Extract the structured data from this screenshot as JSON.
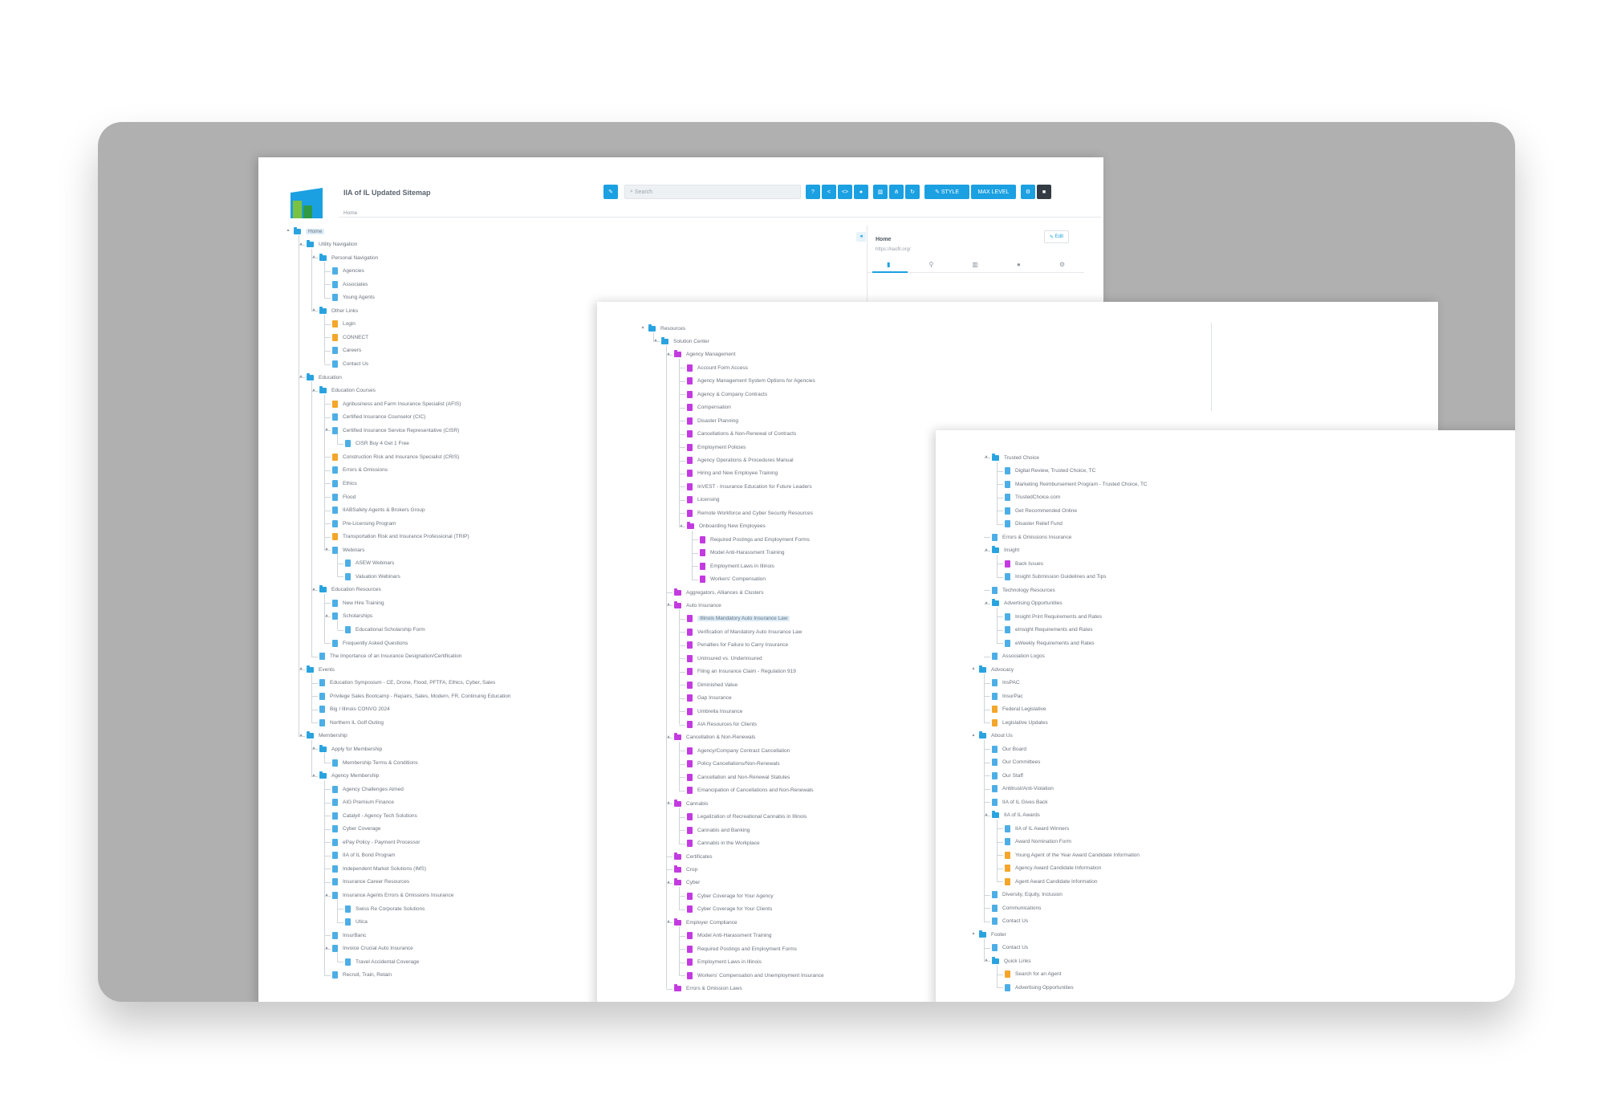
{
  "app": {
    "title": "IIA of IL Updated Sitemap",
    "breadcrumb": "Home",
    "search_placeholder": "Search",
    "toolbar": [
      "STYLE",
      "MAX LEVEL"
    ],
    "side_panel": {
      "title": "Home",
      "url": "https://iiaofil.org/",
      "edit_label": "Edit"
    }
  },
  "colors": {
    "folder": "#29a3df",
    "page_blue": "#4daee6",
    "page_orange": "#f4a62a",
    "page_purple": "#c33be0",
    "accent": "#1ba0e2",
    "stage": "#b0b0b0"
  },
  "sheet1_tree": [
    {
      "d": 0,
      "t": "Home",
      "k": "folder",
      "hl": true
    },
    {
      "d": 1,
      "t": "Utility Navigation",
      "k": "folder"
    },
    {
      "d": 2,
      "t": "Personal Navigation",
      "k": "folder"
    },
    {
      "d": 3,
      "t": "Agencies",
      "k": "blue"
    },
    {
      "d": 3,
      "t": "Associates",
      "k": "blue"
    },
    {
      "d": 3,
      "t": "Young Agents",
      "k": "blue"
    },
    {
      "d": 2,
      "t": "Other Links",
      "k": "folder"
    },
    {
      "d": 3,
      "t": "Login",
      "k": "orange"
    },
    {
      "d": 3,
      "t": "CONNECT",
      "k": "orange"
    },
    {
      "d": 3,
      "t": "Careers",
      "k": "blue"
    },
    {
      "d": 3,
      "t": "Contact Us",
      "k": "blue"
    },
    {
      "d": 1,
      "t": "Education",
      "k": "folder"
    },
    {
      "d": 2,
      "t": "Education Courses",
      "k": "folder"
    },
    {
      "d": 3,
      "t": "Agribusiness and Farm Insurance Specialist (AFIS)",
      "k": "orange"
    },
    {
      "d": 3,
      "t": "Certified Insurance Counselor (CIC)",
      "k": "blue"
    },
    {
      "d": 3,
      "t": "Certified Insurance Service Representative (CISR)",
      "k": "blue"
    },
    {
      "d": 4,
      "t": "CISR Buy 4 Get 1 Free",
      "k": "blue"
    },
    {
      "d": 3,
      "t": "Construction Risk and Insurance Specialist (CRIS)",
      "k": "orange"
    },
    {
      "d": 3,
      "t": "Errors & Omissions",
      "k": "blue"
    },
    {
      "d": 3,
      "t": "Ethics",
      "k": "blue"
    },
    {
      "d": 3,
      "t": "Flood",
      "k": "blue"
    },
    {
      "d": 3,
      "t": "IIABSafety Agents & Brokers Group",
      "k": "blue"
    },
    {
      "d": 3,
      "t": "Pre-Licensing Program",
      "k": "blue"
    },
    {
      "d": 3,
      "t": "Transportation Risk and Insurance Professional (TRIP)",
      "k": "orange"
    },
    {
      "d": 3,
      "t": "Webinars",
      "k": "blue"
    },
    {
      "d": 4,
      "t": "ASEW Webinars",
      "k": "blue"
    },
    {
      "d": 4,
      "t": "Valuation Webinars",
      "k": "blue"
    },
    {
      "d": 2,
      "t": "Education Resources",
      "k": "folder"
    },
    {
      "d": 3,
      "t": "New Hire Training",
      "k": "blue"
    },
    {
      "d": 3,
      "t": "Scholarships",
      "k": "blue"
    },
    {
      "d": 4,
      "t": "Educational Scholarship Form",
      "k": "blue"
    },
    {
      "d": 3,
      "t": "Frequently Asked Questions",
      "k": "blue"
    },
    {
      "d": 2,
      "t": "The Importance of an Insurance Designation/Certification",
      "k": "blue"
    },
    {
      "d": 1,
      "t": "Events",
      "k": "folder"
    },
    {
      "d": 2,
      "t": "Education Symposium - CE, Drone, Flood, PFTFA, Ethics, Cyber, Sales",
      "k": "blue"
    },
    {
      "d": 2,
      "t": "Privilege Sales Bootcamp - Repairs, Sales, Modern, FR, Continuing Education",
      "k": "blue"
    },
    {
      "d": 2,
      "t": "Big I Illinois CONVO 2024",
      "k": "blue"
    },
    {
      "d": 2,
      "t": "Northern IL Golf Outing",
      "k": "blue"
    },
    {
      "d": 1,
      "t": "Membership",
      "k": "folder"
    },
    {
      "d": 2,
      "t": "Apply for Membership",
      "k": "folder"
    },
    {
      "d": 3,
      "t": "Membership Terms & Conditions",
      "k": "blue"
    },
    {
      "d": 2,
      "t": "Agency Membership",
      "k": "folder"
    },
    {
      "d": 3,
      "t": "Agency Challenges Aimed",
      "k": "blue"
    },
    {
      "d": 3,
      "t": "AIG Premium Finance",
      "k": "blue"
    },
    {
      "d": 3,
      "t": "Catalyit - Agency Tech Solutions",
      "k": "blue"
    },
    {
      "d": 3,
      "t": "Cyber Coverage",
      "k": "blue"
    },
    {
      "d": 3,
      "t": "ePay Policy - Payment Processor",
      "k": "blue"
    },
    {
      "d": 3,
      "t": "IIA of IL Bond Program",
      "k": "blue"
    },
    {
      "d": 3,
      "t": "Independent Market Solutions (IMS)",
      "k": "blue"
    },
    {
      "d": 3,
      "t": "Insurance Career Resources",
      "k": "blue"
    },
    {
      "d": 3,
      "t": "Insurance Agents Errors & Omissions Insurance",
      "k": "blue"
    },
    {
      "d": 4,
      "t": "Swiss Re Corporate Solutions",
      "k": "blue"
    },
    {
      "d": 4,
      "t": "Utica",
      "k": "blue"
    },
    {
      "d": 3,
      "t": "InsurBanc",
      "k": "blue"
    },
    {
      "d": 3,
      "t": "Invoice Crucial Auto Insurance",
      "k": "blue"
    },
    {
      "d": 4,
      "t": "Travel Accidental Coverage",
      "k": "blue"
    },
    {
      "d": 3,
      "t": "Recruit, Train, Retain",
      "k": "blue"
    }
  ],
  "sheet2_tree": [
    {
      "d": 0,
      "t": "Resources",
      "k": "folder"
    },
    {
      "d": 1,
      "t": "Solution Center",
      "k": "folder"
    },
    {
      "d": 2,
      "t": "Agency Management",
      "k": "pfolder"
    },
    {
      "d": 3,
      "t": "Account Form Access",
      "k": "purple"
    },
    {
      "d": 3,
      "t": "Agency Management System Options for Agencies",
      "k": "purple"
    },
    {
      "d": 3,
      "t": "Agency & Company Contracts",
      "k": "purple"
    },
    {
      "d": 3,
      "t": "Compensation",
      "k": "purple"
    },
    {
      "d": 3,
      "t": "Disaster Planning",
      "k": "purple"
    },
    {
      "d": 3,
      "t": "Cancellations & Non-Renewal of Contracts",
      "k": "purple"
    },
    {
      "d": 3,
      "t": "Employment Policies",
      "k": "purple"
    },
    {
      "d": 3,
      "t": "Agency Operations & Procedures Manual",
      "k": "purple"
    },
    {
      "d": 3,
      "t": "Hiring and New Employee Training",
      "k": "purple"
    },
    {
      "d": 3,
      "t": "InVEST - Insurance Education for Future Leaders",
      "k": "purple"
    },
    {
      "d": 3,
      "t": "Licensing",
      "k": "purple"
    },
    {
      "d": 3,
      "t": "Remote Workforce and Cyber Security Resources",
      "k": "purple"
    },
    {
      "d": 3,
      "t": "Onboarding New Employees",
      "k": "pfolder"
    },
    {
      "d": 4,
      "t": "Required Postings and Employment Forms",
      "k": "purple"
    },
    {
      "d": 4,
      "t": "Model Anti-Harassment Training",
      "k": "purple"
    },
    {
      "d": 4,
      "t": "Employment Laws in Illinois",
      "k": "purple"
    },
    {
      "d": 4,
      "t": "Workers' Compensation",
      "k": "purple"
    },
    {
      "d": 2,
      "t": "Aggregators, Alliances & Clusters",
      "k": "pfolder"
    },
    {
      "d": 2,
      "t": "Auto Insurance",
      "k": "pfolder"
    },
    {
      "d": 3,
      "t": "Illinois Mandatory Auto Insurance Law",
      "k": "purple",
      "hl": true
    },
    {
      "d": 3,
      "t": "Verification of Mandatory Auto Insurance Law",
      "k": "purple"
    },
    {
      "d": 3,
      "t": "Penalties for Failure to Carry Insurance",
      "k": "purple"
    },
    {
      "d": 3,
      "t": "Uninsured vs. Underinsured",
      "k": "purple"
    },
    {
      "d": 3,
      "t": "Filing an Insurance Claim - Regulation 919",
      "k": "purple"
    },
    {
      "d": 3,
      "t": "Diminished Value",
      "k": "purple"
    },
    {
      "d": 3,
      "t": "Gap Insurance",
      "k": "purple"
    },
    {
      "d": 3,
      "t": "Umbrella Insurance",
      "k": "purple"
    },
    {
      "d": 3,
      "t": "AIA Resources for Clients",
      "k": "purple"
    },
    {
      "d": 2,
      "t": "Cancellation & Non-Renewals",
      "k": "pfolder"
    },
    {
      "d": 3,
      "t": "Agency/Company Contract Cancellation",
      "k": "purple"
    },
    {
      "d": 3,
      "t": "Policy Cancellations/Non-Renewals",
      "k": "purple"
    },
    {
      "d": 3,
      "t": "Cancellation and Non-Renewal Statutes",
      "k": "purple"
    },
    {
      "d": 3,
      "t": "Emancipation of Cancellations and Non-Renewals",
      "k": "purple"
    },
    {
      "d": 2,
      "t": "Cannabis",
      "k": "pfolder"
    },
    {
      "d": 3,
      "t": "Legalization of Recreational Cannabis in Illinois",
      "k": "purple"
    },
    {
      "d": 3,
      "t": "Cannabis and Banking",
      "k": "purple"
    },
    {
      "d": 3,
      "t": "Cannabis in the Workplace",
      "k": "purple"
    },
    {
      "d": 2,
      "t": "Certificates",
      "k": "pfolder"
    },
    {
      "d": 2,
      "t": "Crop",
      "k": "pfolder"
    },
    {
      "d": 2,
      "t": "Cyber",
      "k": "pfolder"
    },
    {
      "d": 3,
      "t": "Cyber Coverage for Your Agency",
      "k": "purple"
    },
    {
      "d": 3,
      "t": "Cyber Coverage for Your Clients",
      "k": "purple"
    },
    {
      "d": 2,
      "t": "Employer Compliance",
      "k": "pfolder"
    },
    {
      "d": 3,
      "t": "Model Anti-Harassment Training",
      "k": "purple"
    },
    {
      "d": 3,
      "t": "Required Postings and Employment Forms",
      "k": "purple"
    },
    {
      "d": 3,
      "t": "Employment Laws in Illinois",
      "k": "purple"
    },
    {
      "d": 3,
      "t": "Workers' Compensation and Unemployment Insurance",
      "k": "purple"
    },
    {
      "d": 2,
      "t": "Errors & Omission Laws",
      "k": "pfolder"
    }
  ],
  "sheet3_tree": [
    {
      "d": 1,
      "t": "Trusted Choice",
      "k": "folder"
    },
    {
      "d": 2,
      "t": "Digital Review, Trusted Choice, TC",
      "k": "blue"
    },
    {
      "d": 2,
      "t": "Marketing Reimbursement Program - Trusted Choice, TC",
      "k": "blue"
    },
    {
      "d": 2,
      "t": "TrustedChoice.com",
      "k": "blue"
    },
    {
      "d": 2,
      "t": "Get Recommended Online",
      "k": "blue"
    },
    {
      "d": 2,
      "t": "Disaster Relief Fund",
      "k": "blue"
    },
    {
      "d": 1,
      "t": "Errors & Omissions Insurance",
      "k": "blue"
    },
    {
      "d": 1,
      "t": "Insight",
      "k": "folder"
    },
    {
      "d": 2,
      "t": "Back Issues",
      "k": "purple"
    },
    {
      "d": 2,
      "t": "Insight Submission Guidelines and Tips",
      "k": "blue"
    },
    {
      "d": 1,
      "t": "Technology Resources",
      "k": "blue"
    },
    {
      "d": 1,
      "t": "Advertising Opportunities",
      "k": "folder"
    },
    {
      "d": 2,
      "t": "Insight Print Requirements and Rates",
      "k": "blue"
    },
    {
      "d": 2,
      "t": "eInsight Requirements and Rates",
      "k": "blue"
    },
    {
      "d": 2,
      "t": "eWeekly Requirements and Rates",
      "k": "blue"
    },
    {
      "d": 1,
      "t": "Association Logos",
      "k": "blue"
    },
    {
      "d": 0,
      "t": "Advocacy",
      "k": "folder"
    },
    {
      "d": 1,
      "t": "InsPAC",
      "k": "blue"
    },
    {
      "d": 1,
      "t": "InsurPac",
      "k": "blue"
    },
    {
      "d": 1,
      "t": "Federal Legislative",
      "k": "orange"
    },
    {
      "d": 1,
      "t": "Legislative Updates",
      "k": "orange"
    },
    {
      "d": 0,
      "t": "About Us",
      "k": "folder"
    },
    {
      "d": 1,
      "t": "Our Board",
      "k": "blue"
    },
    {
      "d": 1,
      "t": "Our Committees",
      "k": "blue"
    },
    {
      "d": 1,
      "t": "Our Staff",
      "k": "blue"
    },
    {
      "d": 1,
      "t": "Antitrust/Anti-Violation",
      "k": "blue"
    },
    {
      "d": 1,
      "t": "IIA of IL Gives Back",
      "k": "blue"
    },
    {
      "d": 1,
      "t": "IIA of IL Awards",
      "k": "folder"
    },
    {
      "d": 2,
      "t": "IIA of IL Award Winners",
      "k": "blue"
    },
    {
      "d": 2,
      "t": "Award Nomination Form",
      "k": "blue"
    },
    {
      "d": 2,
      "t": "Young Agent of the Year Award Candidate Information",
      "k": "orange"
    },
    {
      "d": 2,
      "t": "Agency Award Candidate Information",
      "k": "orange"
    },
    {
      "d": 2,
      "t": "Agent Award Candidate Information",
      "k": "orange"
    },
    {
      "d": 1,
      "t": "Diversity, Equity, Inclusion",
      "k": "blue"
    },
    {
      "d": 1,
      "t": "Communications",
      "k": "blue"
    },
    {
      "d": 1,
      "t": "Contact Us",
      "k": "blue"
    },
    {
      "d": 0,
      "t": "Footer",
      "k": "folder"
    },
    {
      "d": 1,
      "t": "Contact Us",
      "k": "blue"
    },
    {
      "d": 1,
      "t": "Quick Links",
      "k": "folder"
    },
    {
      "d": 2,
      "t": "Search for an Agent",
      "k": "orange"
    },
    {
      "d": 2,
      "t": "Advertising Opportunities",
      "k": "blue"
    }
  ]
}
